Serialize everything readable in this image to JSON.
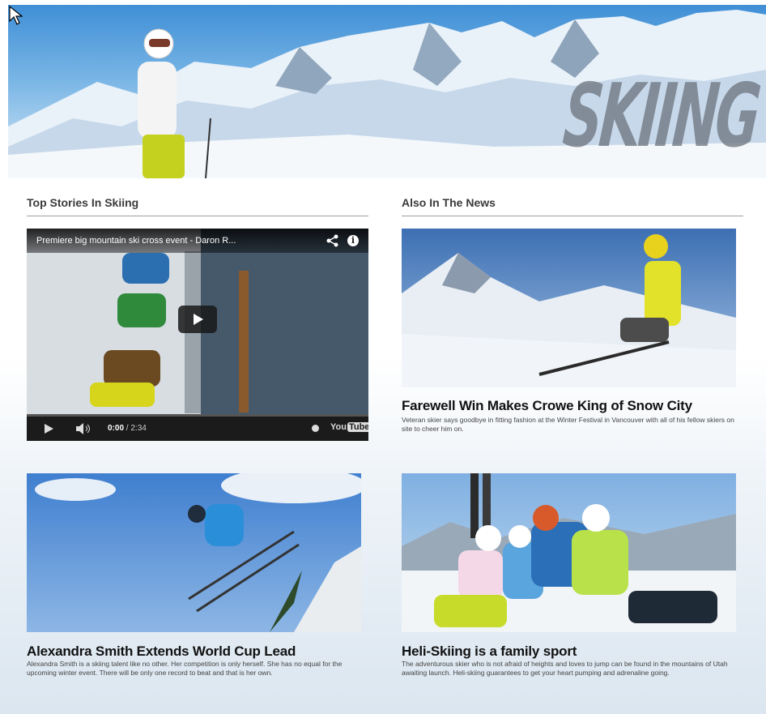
{
  "hero": {
    "word": "SKIING"
  },
  "sections": {
    "left_title": "Top Stories In Skiing",
    "right_title": "Also In The News"
  },
  "video": {
    "title": "Premiere big mountain ski cross event - Daron R...",
    "current_time": "0:00",
    "duration": "/ 2:34",
    "brand": "You",
    "brand_box": "Tube"
  },
  "stories": [
    {
      "title": "Farewell Win Makes Crowe King of Snow City",
      "description": "Veteran skier says goodbye in fitting fashion at the Winter Festival in Vancouver with all of his fellow skiers on site to cheer him on."
    },
    {
      "title": "Alexandra Smith Extends World Cup Lead",
      "description": "Alexandra Smith is a skiing talent like no other. Her competition is only herself. She has no equal for the upcoming winter event. There will be only one record to beat and that is her own."
    },
    {
      "title": "Heli-Skiing is a family sport",
      "description": "The adventurous skier who is not afraid of heights and loves to jump can be found in the mountains of Utah awaiting launch. Heli-skiing guarantees to get your heart pumping and adrenaline going."
    }
  ]
}
